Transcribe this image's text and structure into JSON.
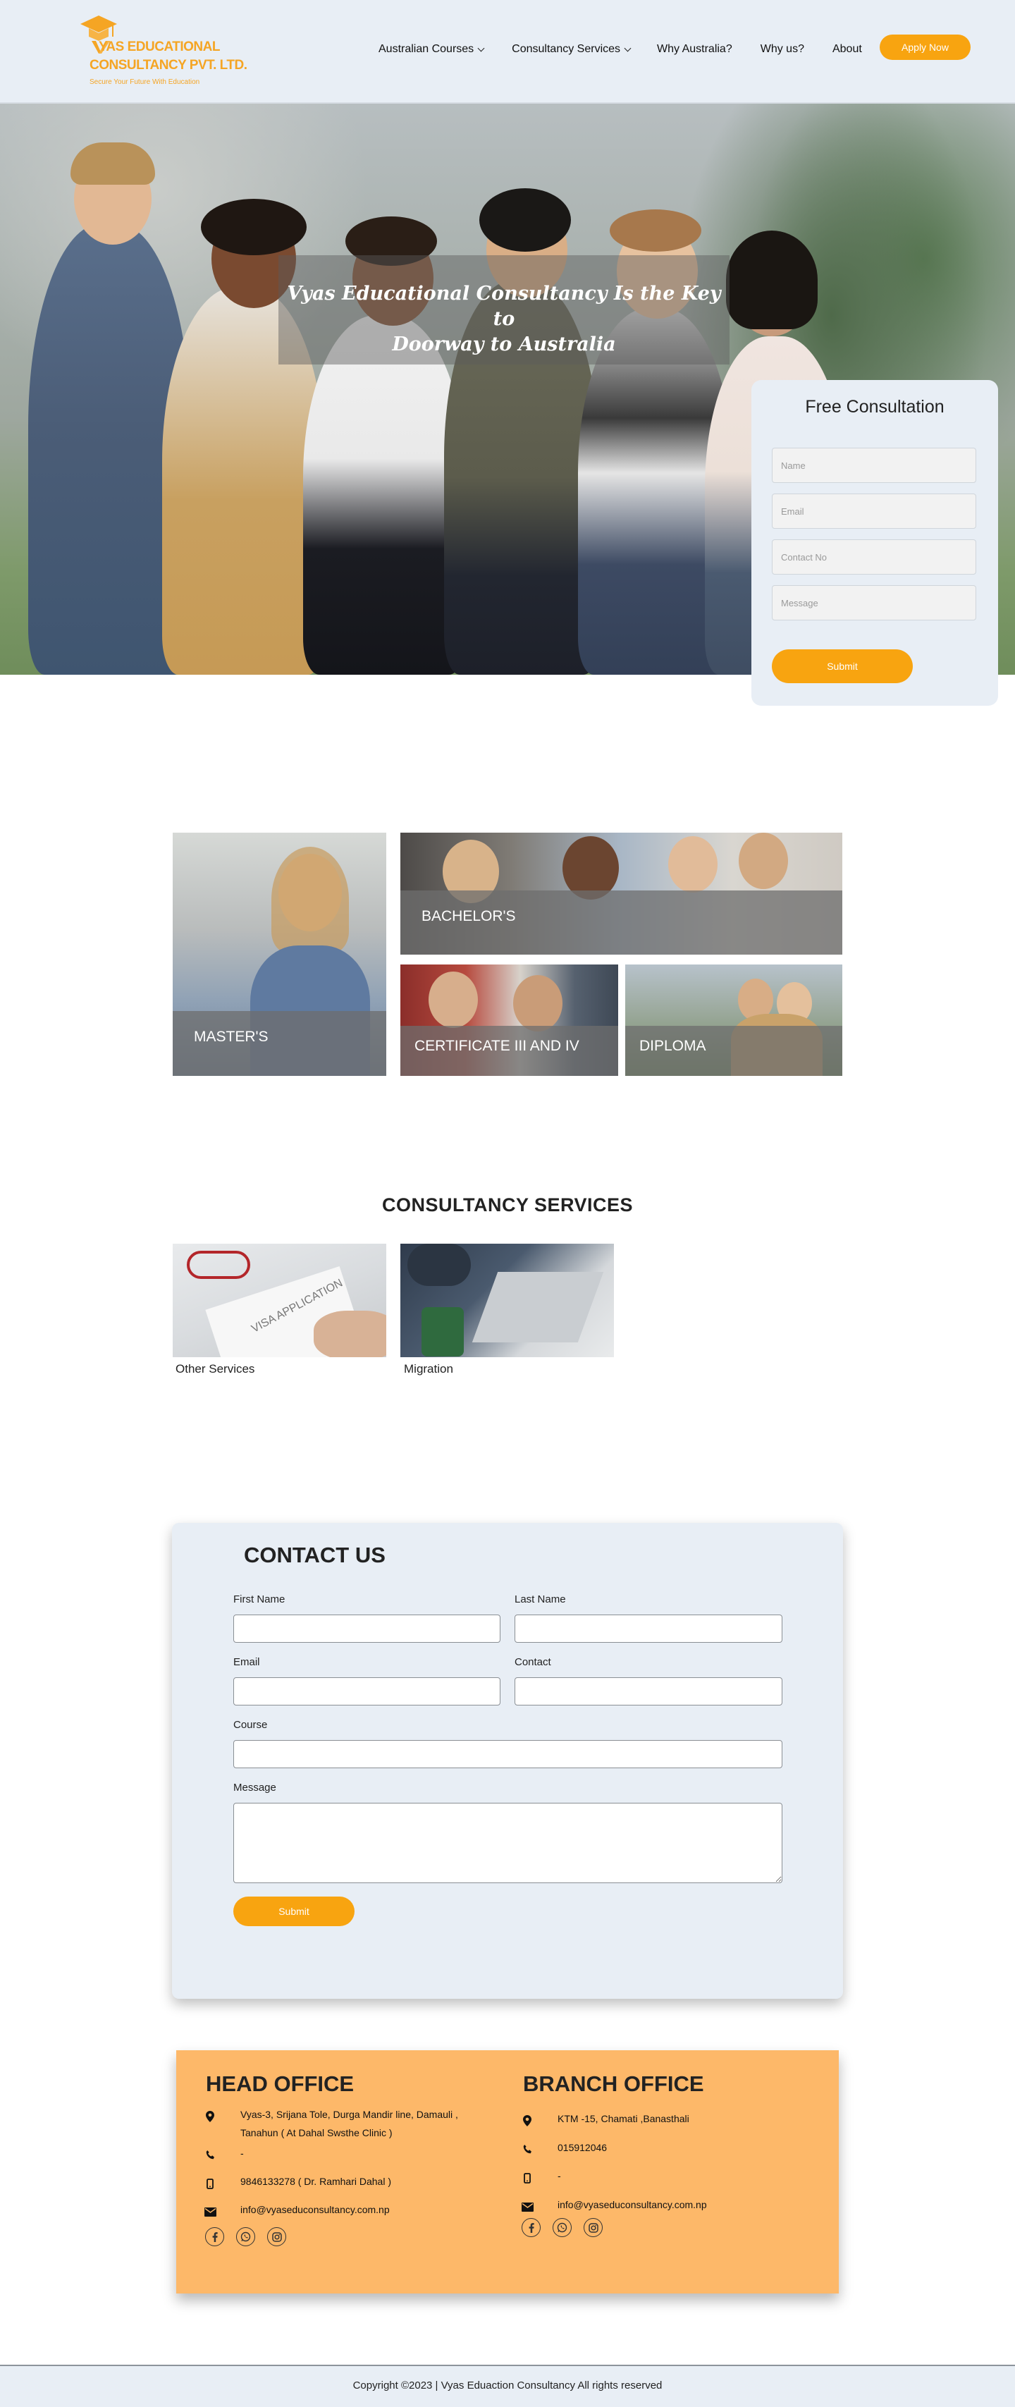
{
  "brand": {
    "name_line1": "YAS EDUCATIONAL",
    "name_line2": "CONSULTANCY PVT. LTD.",
    "tagline": "Secure Your Future With Education",
    "accent": "#f8a410",
    "logo_mark": "graduation-cap-v"
  },
  "nav": {
    "items": [
      {
        "label": "Australian Courses",
        "dropdown": true
      },
      {
        "label": "Consultancy Services",
        "dropdown": true
      },
      {
        "label": "Why Australia?",
        "dropdown": false
      },
      {
        "label": "Why us?",
        "dropdown": false
      },
      {
        "label": "About",
        "dropdown": false
      }
    ],
    "cta": "Apply Now"
  },
  "hero": {
    "title_line1": "Vyas Educational Consultancy Is the Key to",
    "title_line2": "Doorway to Australia"
  },
  "consultation": {
    "title": "Free Consultation",
    "fields": {
      "name": "Name",
      "email": "Email",
      "contact": "Contact No",
      "message": "Message"
    },
    "submit": "Submit"
  },
  "courses": {
    "masters": "MASTER'S",
    "bachelors": "BACHELOR'S",
    "certificate": "CERTIFICATE III AND IV",
    "diploma": "DIPLOMA"
  },
  "services": {
    "title": "CONSULTANCY SERVICES",
    "items": [
      {
        "label": "Other Services"
      },
      {
        "label": "Migration"
      }
    ]
  },
  "contact": {
    "title": "CONTACT US",
    "first_name": "First Name",
    "last_name": "Last Name",
    "email": "Email",
    "contact": "Contact",
    "course": "Course",
    "message": "Message",
    "submit": "Submit"
  },
  "head_office": {
    "title": "HEAD OFFICE",
    "address_line1": "Vyas-3, Srijana Tole, Durga Mandir line, Damauli ,",
    "address_line2": "Tanahun ( At Dahal Swsthe Clinic )",
    "phone": "-",
    "mobile": "9846133278 ( Dr. Ramhari Dahal )",
    "email": "info@vyaseduconsultancy.com.np"
  },
  "branch_office": {
    "title": "BRANCH OFFICE",
    "address": "KTM -15, Chamati ,Banasthali",
    "phone": "015912046",
    "mobile": "-",
    "email": "info@vyaseduconsultancy.com.np"
  },
  "footer": {
    "copyright": "Copyright ©2023 | Vyas Eduaction Consultancy All rights reserved"
  }
}
